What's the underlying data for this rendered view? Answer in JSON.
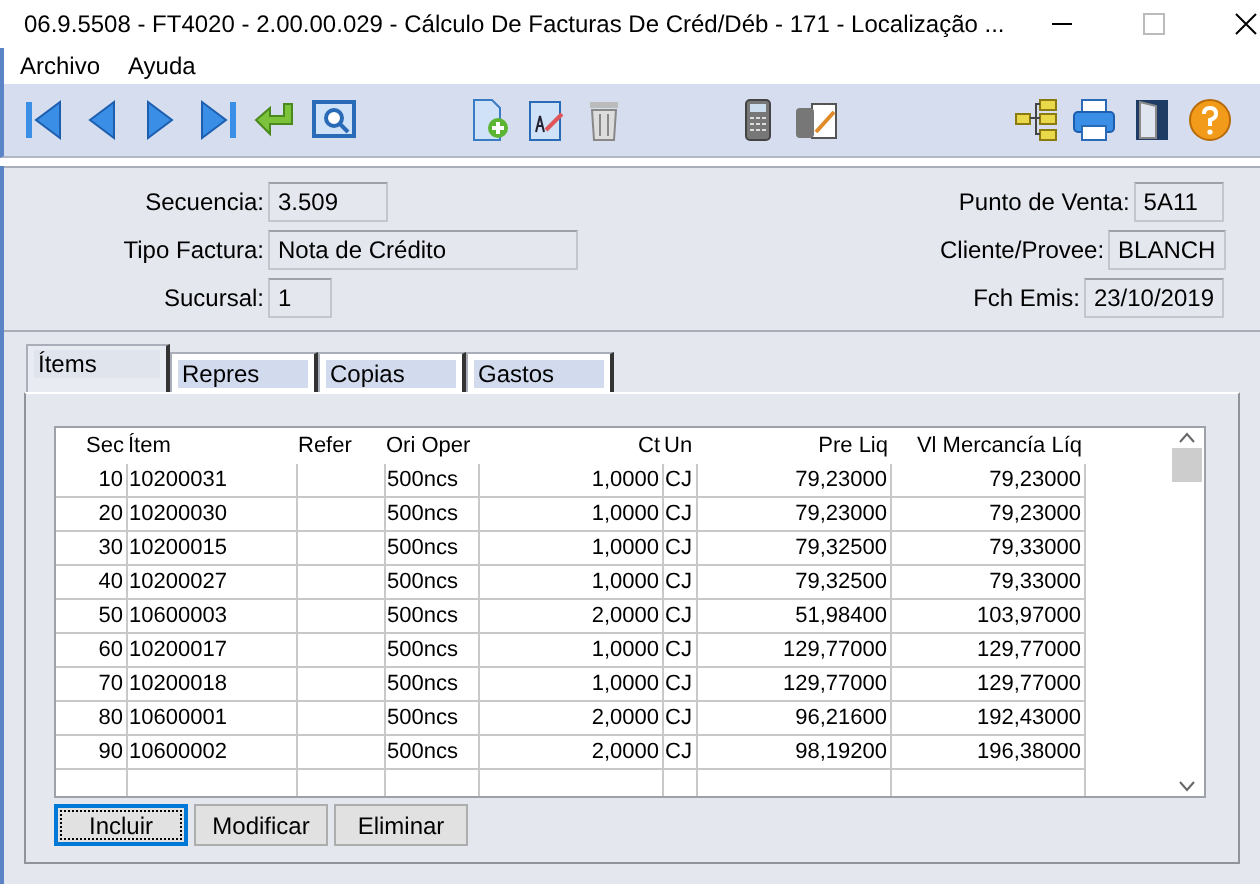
{
  "window": {
    "title": "06.9.5508 - FT4020 - 2.00.00.029 - Cálculo De Facturas De Créd/Déb - 171 - Localização ..."
  },
  "menu": [
    "Archivo",
    "Ayuda"
  ],
  "form": {
    "left": [
      {
        "label": "Secuencia:",
        "value": "3.509"
      },
      {
        "label": "Tipo Factura:",
        "value": "Nota de Crédito"
      },
      {
        "label": "Sucursal:",
        "value": "1"
      }
    ],
    "right": [
      {
        "label": "Punto de Venta:",
        "value": "5A11"
      },
      {
        "label": "Cliente/Provee:",
        "value": "BLANCH"
      },
      {
        "label": "Fch Emis:",
        "value": "23/10/2019"
      }
    ]
  },
  "tabs": [
    {
      "label": "Ítems",
      "selected": true
    },
    {
      "label": "Repres",
      "selected": false
    },
    {
      "label": "Copias",
      "selected": false
    },
    {
      "label": "Gastos",
      "selected": false
    }
  ],
  "table": {
    "columns": [
      "Sec",
      "Ítem",
      "Refer",
      "Ori Oper",
      "Ct",
      "Un",
      "Pre Liq",
      "Vl Mercancía Líq"
    ],
    "rows": [
      [
        "10",
        "10200031",
        "",
        "500ncs",
        "1,0000",
        "CJ",
        "79,23000",
        "79,23000"
      ],
      [
        "20",
        "10200030",
        "",
        "500ncs",
        "1,0000",
        "CJ",
        "79,23000",
        "79,23000"
      ],
      [
        "30",
        "10200015",
        "",
        "500ncs",
        "1,0000",
        "CJ",
        "79,32500",
        "79,33000"
      ],
      [
        "40",
        "10200027",
        "",
        "500ncs",
        "1,0000",
        "CJ",
        "79,32500",
        "79,33000"
      ],
      [
        "50",
        "10600003",
        "",
        "500ncs",
        "2,0000",
        "CJ",
        "51,98400",
        "103,97000"
      ],
      [
        "60",
        "10200017",
        "",
        "500ncs",
        "1,0000",
        "CJ",
        "129,77000",
        "129,77000"
      ],
      [
        "70",
        "10200018",
        "",
        "500ncs",
        "1,0000",
        "CJ",
        "129,77000",
        "129,77000"
      ],
      [
        "80",
        "10600001",
        "",
        "500ncs",
        "2,0000",
        "CJ",
        "96,21600",
        "192,43000"
      ],
      [
        "90",
        "10600002",
        "",
        "500ncs",
        "2,0000",
        "CJ",
        "98,19200",
        "196,38000"
      ]
    ]
  },
  "buttons": [
    {
      "label": "Incluir",
      "selected": true
    },
    {
      "label": "Modificar",
      "selected": false
    },
    {
      "label": "Eliminar",
      "selected": false
    }
  ]
}
